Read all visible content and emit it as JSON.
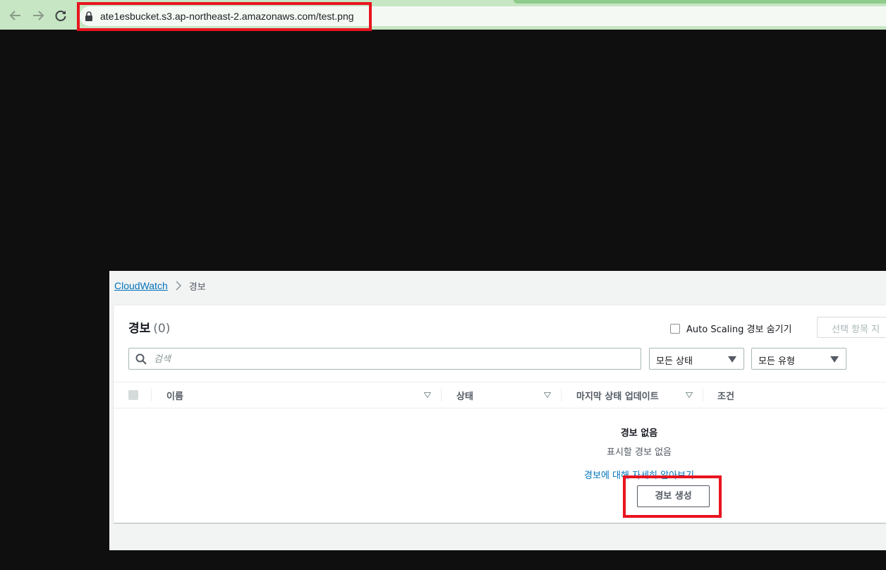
{
  "browser": {
    "url": "ate1esbucket.s3.ap-northeast-2.amazonaws.com/test.png",
    "highlight_color": "#e8141f",
    "chrome_color": "#c6e6c4"
  },
  "breadcrumb": {
    "root": "CloudWatch",
    "current": "경보"
  },
  "alarms_panel": {
    "title": "경보",
    "count": "(0)",
    "autoscaling_label": "Auto Scaling 경보 숨기기",
    "delete_label": "선택 항목 지",
    "search_placeholder": "검색",
    "state_filter": "모든 상태",
    "type_filter": "모든 유형",
    "columns": [
      "이름",
      "상태",
      "마지막 상태 업데이트",
      "조건"
    ],
    "empty_title": "경보 없음",
    "empty_subtitle": "표시할 경보 없음",
    "learn_more_link": "경보에 대해 자세히 알아보기",
    "create_button": "경보 생성"
  },
  "icons": [
    "back-arrow-icon",
    "forward-arrow-icon",
    "reload-icon",
    "lock-icon",
    "chevron-right-icon",
    "search-icon",
    "caret-down-icon",
    "sort-down-icon"
  ]
}
